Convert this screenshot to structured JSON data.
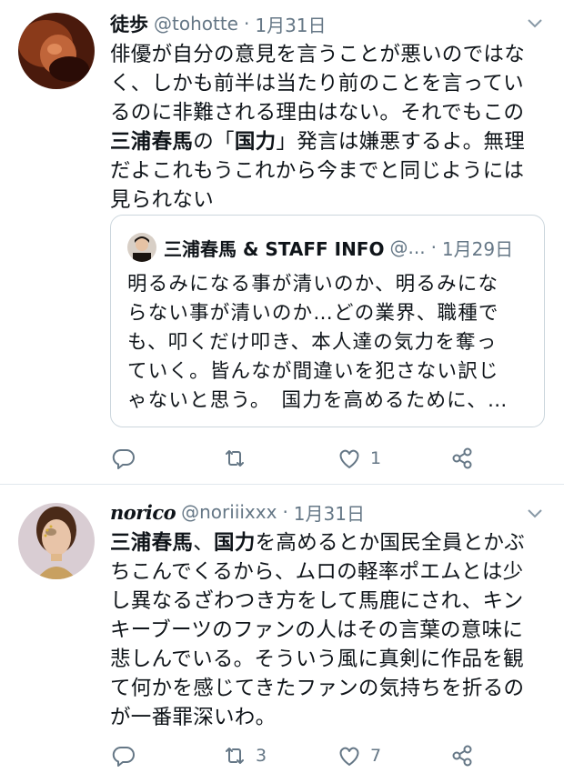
{
  "tweets": [
    {
      "name": "徒歩",
      "handle": "@tohotte",
      "dot": "·",
      "date": "1月31日",
      "text_lines": [
        [
          {
            "t": "俳優が自分の意見を言うことが悪いのではな"
          }
        ],
        [
          {
            "t": "く、しかも前半は当たり前のことを言ってい"
          }
        ],
        [
          {
            "t": "るのに非難される理由はない。それでもこの"
          }
        ],
        [
          {
            "t": "三浦春馬",
            "b": true
          },
          {
            "t": "の「"
          },
          {
            "t": "国力",
            "b": true
          },
          {
            "t": "」発言は嫌悪するよ。無理"
          }
        ],
        [
          {
            "t": "だよこれもうこれから今までと同じようには"
          }
        ],
        [
          {
            "t": "見られない"
          }
        ]
      ],
      "quote": {
        "name": "三浦春馬 & STAFF INFO",
        "handle": "@...",
        "dot": "·",
        "date": "1月29日",
        "lines": [
          "明るみになる事が清いのか、明るみにな",
          "らない事が清いのか…どの業界、職種で",
          "も、叩くだけ叩き、本人達の気力を奪っ",
          "ていく。皆んなが間違いを犯さない訳じ",
          "ゃないと思う。　国力を高めるために、…"
        ]
      },
      "actions": {
        "reply": "",
        "retweet": "",
        "like": "1"
      }
    },
    {
      "name": "norico",
      "handle": "@noriiixxx",
      "dot": "·",
      "date": "1月31日",
      "text_lines": [
        [
          {
            "t": "三浦春馬",
            "b": true
          },
          {
            "t": "、"
          },
          {
            "t": "国力",
            "b": true
          },
          {
            "t": "を高めるとか国民全員とかぶ"
          }
        ],
        [
          {
            "t": "ちこんでくるから、ムロの軽率ポエムとは少"
          }
        ],
        [
          {
            "t": "し異なるざわつき方をして馬鹿にされ、キン"
          }
        ],
        [
          {
            "t": "キーブーツのファンの人はその言葉の意味に"
          }
        ],
        [
          {
            "t": "悲しんでいる。そういう風に真剣に作品を観"
          }
        ],
        [
          {
            "t": "て何かを感じてきたファンの気持ちを折るの"
          }
        ],
        [
          {
            "t": "が一番罪深いわ。"
          }
        ]
      ],
      "actions": {
        "reply": "",
        "retweet": "3",
        "like": "7"
      }
    }
  ],
  "icons": {
    "reply": "reply-icon",
    "retweet": "retweet-icon",
    "like": "heart-icon",
    "share": "share-icon",
    "menu": "chevron-down-icon"
  },
  "colors": {
    "muted": "#657786",
    "border": "#e1e8ed",
    "quote_border": "#ccd6dd"
  }
}
